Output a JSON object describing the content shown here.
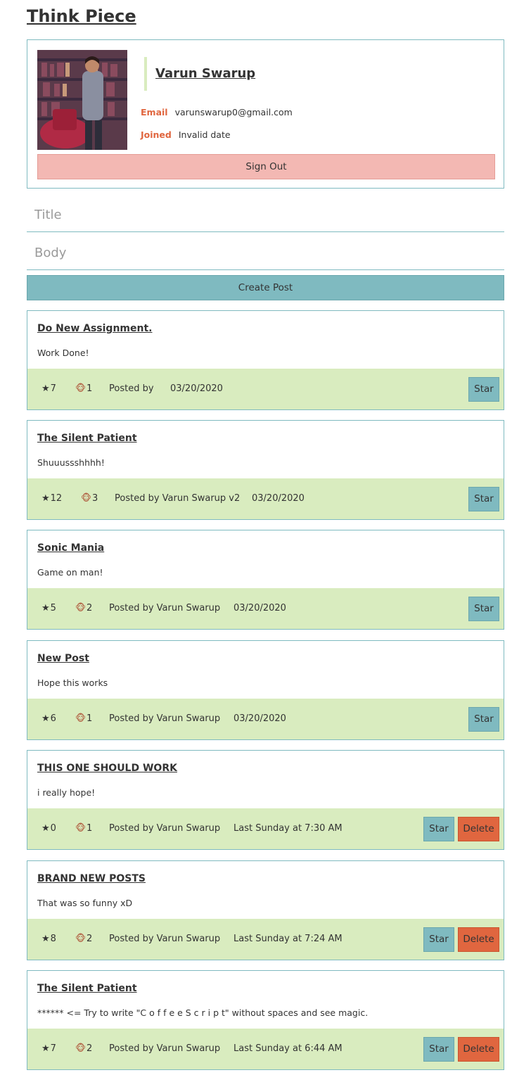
{
  "app": {
    "title": "Think Piece"
  },
  "user": {
    "name": "Varun Swarup",
    "email_label": "Email",
    "email": "varunswarup0@gmail.com",
    "joined_label": "Joined",
    "joined": "Invalid date",
    "sign_out_label": "Sign Out"
  },
  "form": {
    "title_placeholder": "Title",
    "body_placeholder": "Body",
    "create_label": "Create Post"
  },
  "icons": {
    "star": "star-icon",
    "comments": "monkey-icon"
  },
  "colors": {
    "accent": "#7fbac0",
    "footer": "#d9ecbf",
    "danger": "#e0663f",
    "signout": "#f3b8b3"
  },
  "posts": [
    {
      "title": "Do New Assignment.",
      "body": "Work Done!",
      "stars": "7",
      "comments": "1",
      "posted_by": "Posted by",
      "date": "03/20/2020",
      "star_label": "Star"
    },
    {
      "title": "The Silent Patient",
      "body": "Shuuussshhhh!",
      "stars": "12",
      "comments": "3",
      "posted_by": "Posted by Varun Swarup v2",
      "date": "03/20/2020",
      "star_label": "Star"
    },
    {
      "title": "Sonic Mania",
      "body": "Game on man!",
      "stars": "5",
      "comments": "2",
      "posted_by": "Posted by Varun Swarup",
      "date": "03/20/2020",
      "star_label": "Star"
    },
    {
      "title": "New Post",
      "body": "Hope this works",
      "stars": "6",
      "comments": "1",
      "posted_by": "Posted by Varun Swarup",
      "date": "03/20/2020",
      "star_label": "Star"
    },
    {
      "title": "THIS ONE SHOULD WORK",
      "body": "i really hope!",
      "stars": "0",
      "comments": "1",
      "posted_by": "Posted by Varun Swarup",
      "date": "Last Sunday at 7:30 AM",
      "star_label": "Star",
      "delete_label": "Delete"
    },
    {
      "title": "BRAND NEW POSTS",
      "body": "That was so funny xD",
      "stars": "8",
      "comments": "2",
      "posted_by": "Posted by Varun Swarup",
      "date": "Last Sunday at 7:24 AM",
      "star_label": "Star",
      "delete_label": "Delete"
    },
    {
      "title": "The Silent Patient",
      "body": "****** <= Try to write \"C o f f e e S c r i p t\" without spaces and see magic.",
      "stars": "7",
      "comments": "2",
      "posted_by": "Posted by Varun Swarup",
      "date": "Last Sunday at 6:44 AM",
      "star_label": "Star",
      "delete_label": "Delete"
    }
  ]
}
